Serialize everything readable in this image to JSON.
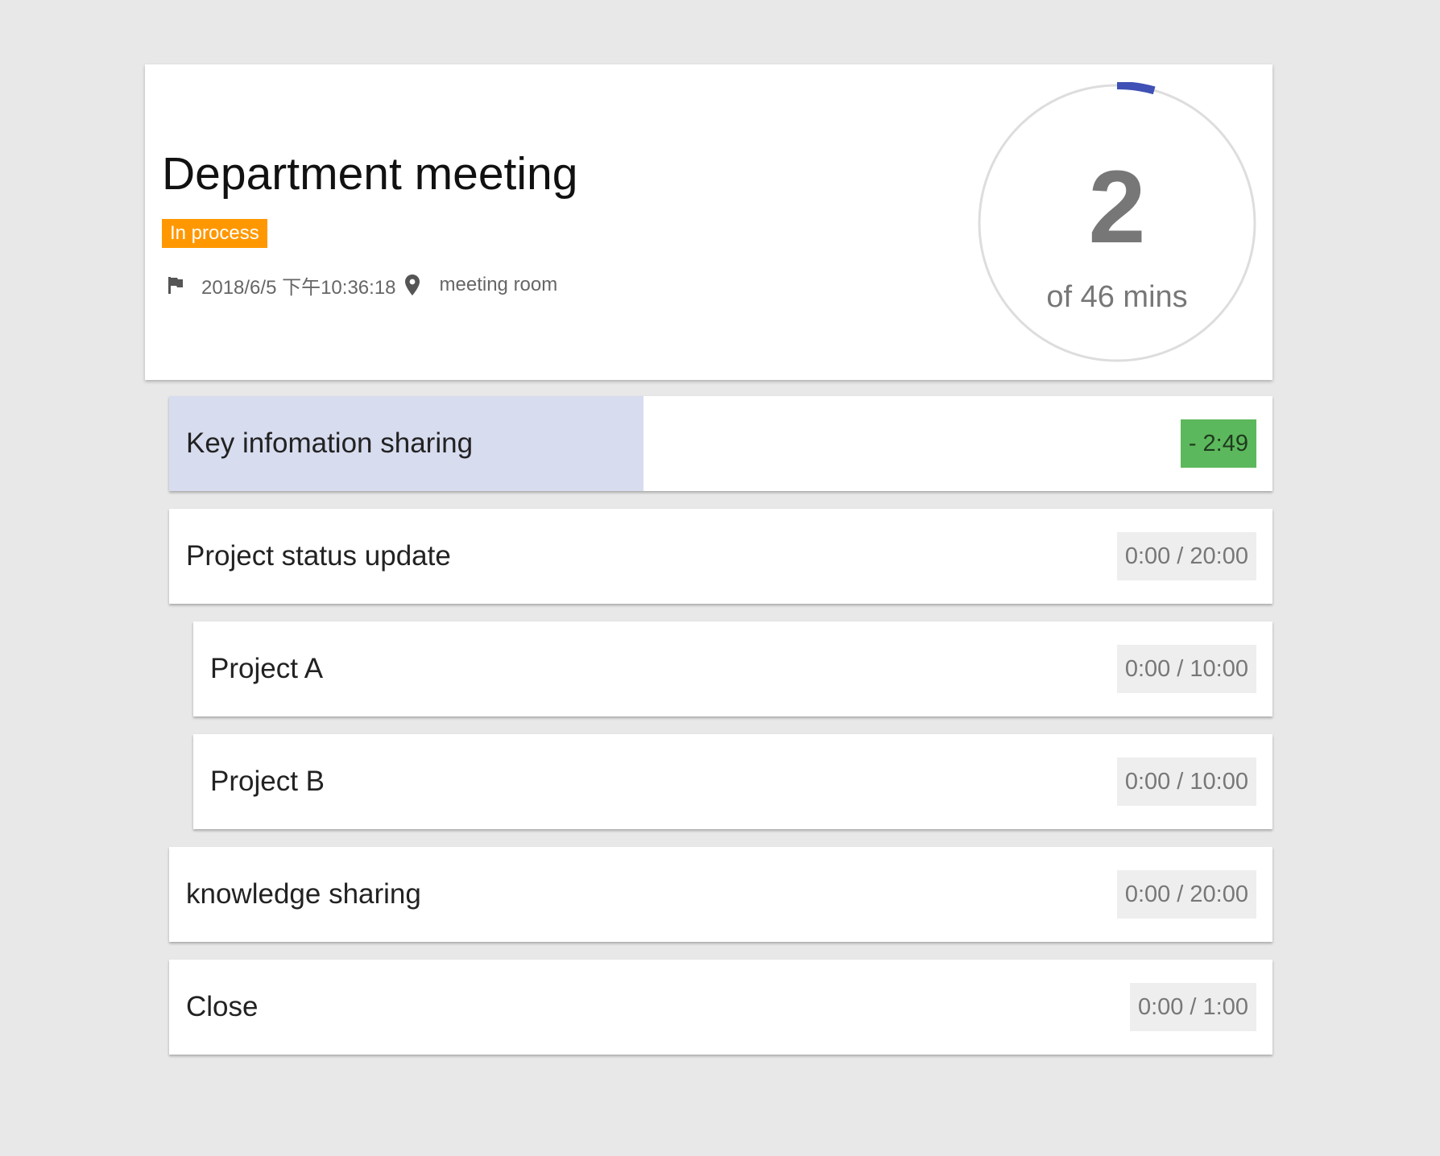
{
  "meeting": {
    "title": "Department meeting",
    "status": "In process",
    "start_time": "2018/6/5 下午10:36:18",
    "location": "meeting room"
  },
  "timer": {
    "elapsed_minutes": "2",
    "total_label": "of 46 mins",
    "progress_fraction": 0.0435
  },
  "agenda": {
    "items": [
      {
        "title": "Key infomation sharing",
        "time": "- 2:49",
        "level": 0,
        "active": true,
        "overtime": true,
        "progress_fraction": 0.43
      },
      {
        "title": "Project status update",
        "time": "0:00 / 20:00",
        "level": 0
      },
      {
        "title": "Project A",
        "time": "0:00 / 10:00",
        "level": 1
      },
      {
        "title": "Project B",
        "time": "0:00 / 10:00",
        "level": 1
      },
      {
        "title": "knowledge sharing",
        "time": "0:00 / 20:00",
        "level": 0
      },
      {
        "title": "Close",
        "time": "0:00 / 1:00",
        "level": 0
      }
    ]
  },
  "colors": {
    "background": "#e8e8e8",
    "status_badge": "#ff9800",
    "timer_arc": "#3f51b5",
    "timer_ring": "#dddddd",
    "active_fill": "#d7dcef",
    "overtime_badge": "#5cb85c",
    "time_badge": "#eeeeee"
  },
  "icons": {
    "start": "flag-icon",
    "location": "location-pin-icon"
  }
}
